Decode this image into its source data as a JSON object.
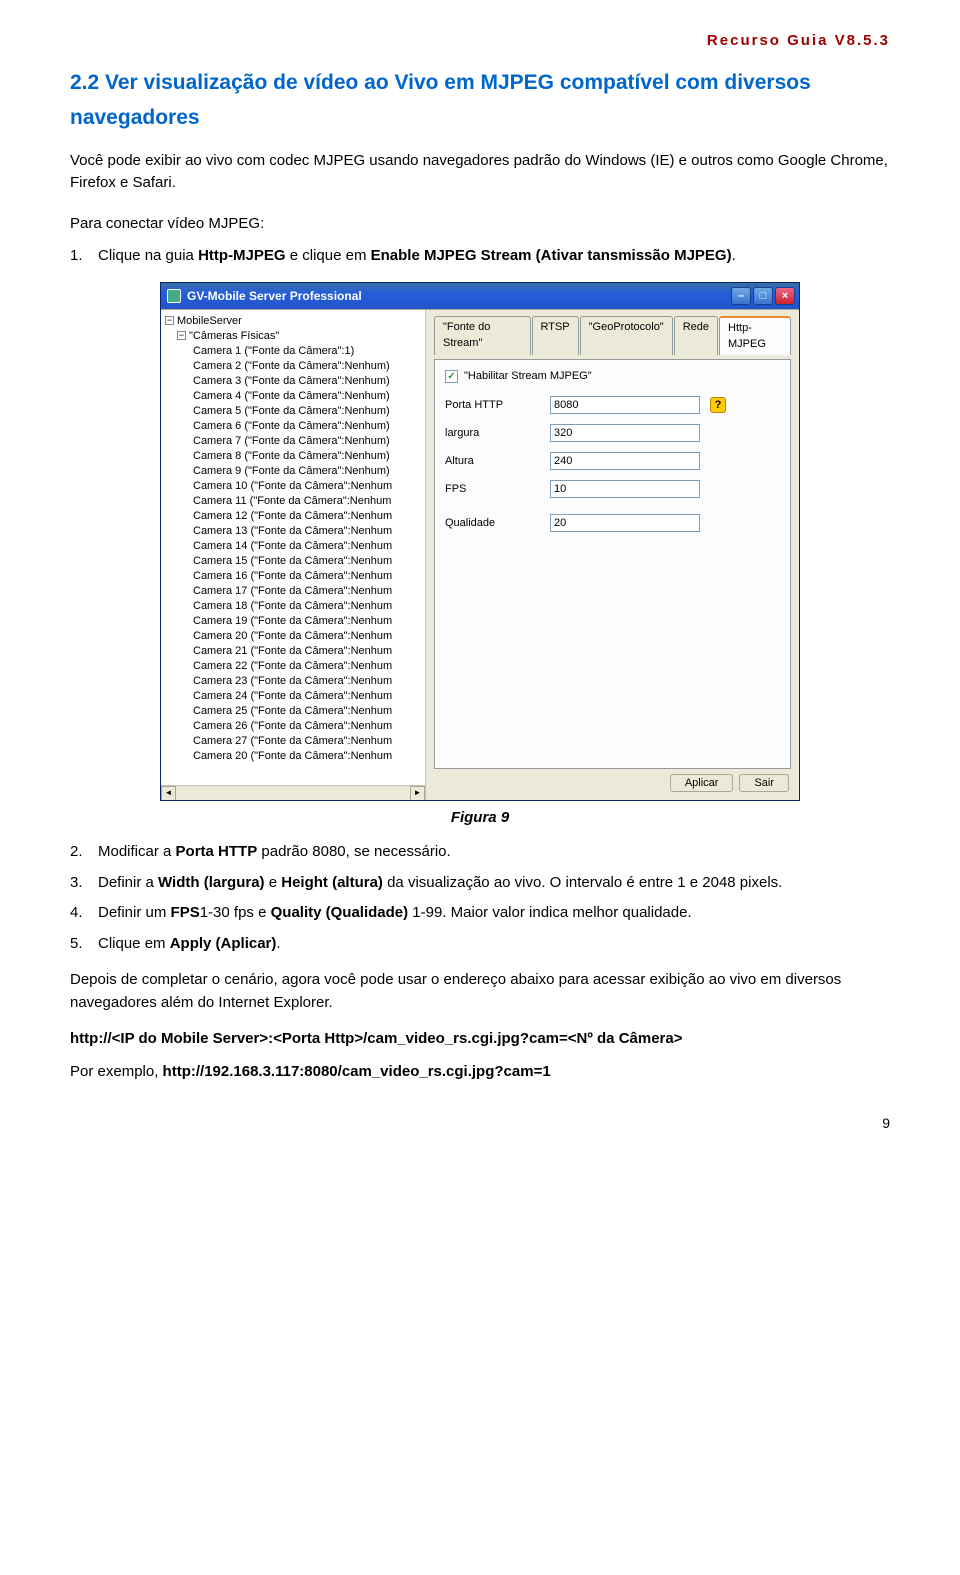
{
  "doc": {
    "header": "Recurso Guia V8.5.3",
    "page_number": "9",
    "section_title": "2.2 Ver visualização de vídeo ao Vivo em MJPEG compatível com diversos navegadores",
    "intro": "Você pode exibir ao vivo com codec MJPEG usando navegadores padrão do Windows (IE) e outros como Google Chrome, Firefox e Safari.",
    "sub_head": "Para conectar vídeo MJPEG:",
    "step1_pre": "Clique na guia ",
    "step1_b1": "Http-MJPEG",
    "step1_mid": " e clique em ",
    "step1_b2": "Enable MJPEG Stream (Ativar tansmissão MJPEG)",
    "step1_post": ".",
    "figcaption": "Figura 9",
    "step2_pre": "Modificar a ",
    "step2_b": "Porta HTTP",
    "step2_post": " padrão 8080, se necessário.",
    "step3_pre": "Definir a ",
    "step3_b1": "Width (largura)",
    "step3_mid1": " e ",
    "step3_b2": "Height (altura)",
    "step3_post": " da visualização ao vivo. O intervalo é entre 1 e 2048 pixels.",
    "step4_pre": "Definir um ",
    "step4_b1": "FPS",
    "step4_mid1": "1-30 fps e ",
    "step4_b2": "Quality (Qualidade)",
    "step4_post": " 1-99. Maior valor indica melhor qualidade.",
    "step5_pre": "Clique em ",
    "step5_b": "Apply (Aplicar)",
    "step5_post": ".",
    "footer_para": "Depois de completar o cenário, agora você pode usar o endereço abaixo para acessar exibição ao vivo em diversos navegadores além do Internet Explorer.",
    "url_template": "http://<IP do Mobile Server>:<Porta Http>/cam_video_rs.cgi.jpg?cam=<Nº da Câmera>",
    "example_pre": "Por exemplo, ",
    "example_url": "http://192.168.3.117:8080/cam_video_rs.cgi.jpg?cam=1"
  },
  "window": {
    "title": "GV-Mobile Server Professional",
    "tree_root": "MobileServer",
    "tree_group": "\"Câmeras Físicas\"",
    "cameras": [
      "Camera 1 (\"Fonte da Câmera\":1)",
      "Camera 2 (\"Fonte da Câmera\":Nenhum)",
      "Camera 3 (\"Fonte da Câmera\":Nenhum)",
      "Camera 4 (\"Fonte da Câmera\":Nenhum)",
      "Camera 5 (\"Fonte da Câmera\":Nenhum)",
      "Camera 6 (\"Fonte da Câmera\":Nenhum)",
      "Camera 7 (\"Fonte da Câmera\":Nenhum)",
      "Camera 8 (\"Fonte da Câmera\":Nenhum)",
      "Camera 9 (\"Fonte da Câmera\":Nenhum)",
      "Camera 10 (\"Fonte da Câmera\":Nenhum",
      "Camera 11 (\"Fonte da Câmera\":Nenhum",
      "Camera 12 (\"Fonte da Câmera\":Nenhum",
      "Camera 13 (\"Fonte da Câmera\":Nenhum",
      "Camera 14 (\"Fonte da Câmera\":Nenhum",
      "Camera 15 (\"Fonte da Câmera\":Nenhum",
      "Camera 16 (\"Fonte da Câmera\":Nenhum",
      "Camera 17 (\"Fonte da Câmera\":Nenhum",
      "Camera 18 (\"Fonte da Câmera\":Nenhum",
      "Camera 19 (\"Fonte da Câmera\":Nenhum",
      "Camera 20 (\"Fonte da Câmera\":Nenhum",
      "Camera 21 (\"Fonte da Câmera\":Nenhum",
      "Camera 22 (\"Fonte da Câmera\":Nenhum",
      "Camera 23 (\"Fonte da Câmera\":Nenhum",
      "Camera 24 (\"Fonte da Câmera\":Nenhum",
      "Camera 25 (\"Fonte da Câmera\":Nenhum",
      "Camera 26 (\"Fonte da Câmera\":Nenhum",
      "Camera 27 (\"Fonte da Câmera\":Nenhum",
      "Camera 20 (\"Fonte da Câmera\":Nenhum"
    ],
    "tabs": [
      "\"Fonte do Stream\"",
      "RTSP",
      "\"GeoProtocolo\"",
      "Rede",
      "Http-MJPEG"
    ],
    "active_tab": 4,
    "checkbox_label": "\"Habilitar Stream MJPEG\"",
    "checkbox_checked": true,
    "fields": {
      "porta_http": {
        "label": "Porta HTTP",
        "value": "8080"
      },
      "largura": {
        "label": "largura",
        "value": "320"
      },
      "altura": {
        "label": "Altura",
        "value": "240"
      },
      "fps": {
        "label": "FPS",
        "value": "10"
      },
      "qualidade": {
        "label": "Qualidade",
        "value": "20"
      }
    },
    "buttons": {
      "apply": "Aplicar",
      "exit": "Sair"
    }
  }
}
